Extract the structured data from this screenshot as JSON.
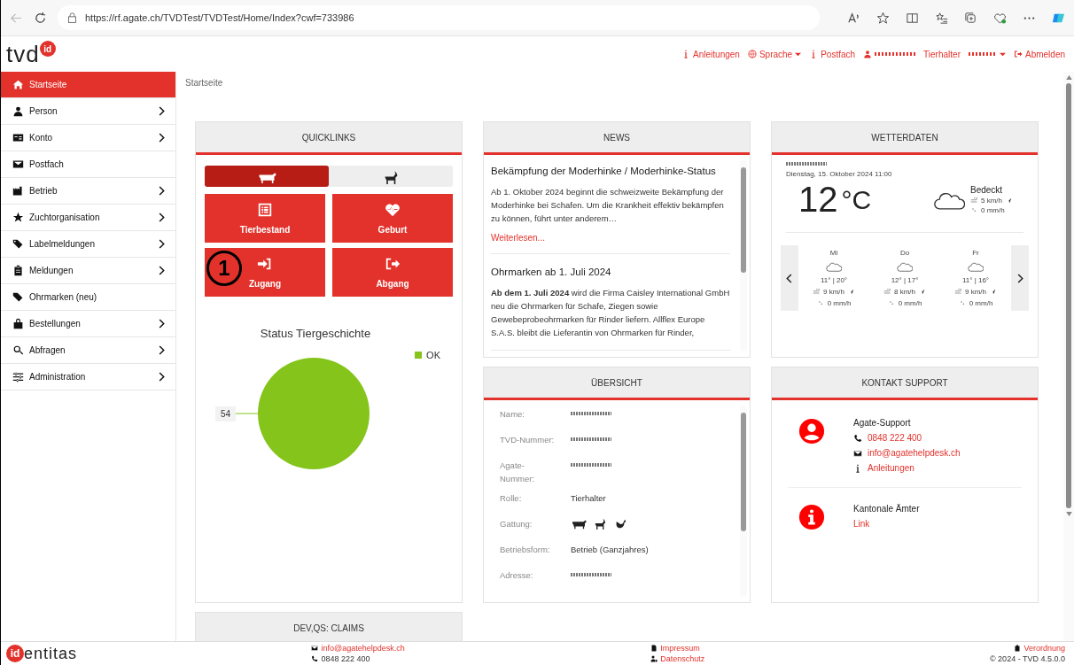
{
  "browser": {
    "url": "https://rf.agate.ch/TVDTest/TVDTest/Home/Index?cwf=733986"
  },
  "header": {
    "logo_text": "tvd",
    "logo_badge": "id",
    "nav": [
      {
        "kind": "link",
        "label": "Anleitungen"
      },
      {
        "kind": "dropdown",
        "label": "Sprache"
      },
      {
        "kind": "link",
        "label": "Postfach"
      },
      {
        "kind": "user"
      },
      {
        "kind": "role",
        "label": "Tierhalter"
      },
      {
        "kind": "logout",
        "label": "Abmelden"
      }
    ]
  },
  "sidebar": {
    "items": [
      {
        "label": "Startseite",
        "selected": true,
        "expandable": false
      },
      {
        "label": "Person",
        "selected": false,
        "expandable": true
      },
      {
        "label": "Konto",
        "selected": false,
        "expandable": true
      },
      {
        "label": "Postfach",
        "selected": false,
        "expandable": false
      },
      {
        "label": "Betrieb",
        "selected": false,
        "expandable": true
      },
      {
        "label": "Zuchtorganisation",
        "selected": false,
        "expandable": true
      },
      {
        "label": "Labelmeldungen",
        "selected": false,
        "expandable": true
      },
      {
        "label": "Meldungen",
        "selected": false,
        "expandable": true
      },
      {
        "label": "Ohrmarken (neu)",
        "selected": false,
        "expandable": false
      },
      {
        "label": "Bestellungen",
        "selected": false,
        "expandable": true
      },
      {
        "label": "Abfragen",
        "selected": false,
        "expandable": true
      },
      {
        "label": "Administration",
        "selected": false,
        "expandable": true
      }
    ]
  },
  "breadcrumb": "Startseite",
  "quicklinks": {
    "title": "QUICKLINKS",
    "species_tabs": [
      {
        "selected": true
      },
      {
        "selected": false
      }
    ],
    "tiles": [
      {
        "label": "Tierbestand"
      },
      {
        "label": "Geburt"
      },
      {
        "label": "Zugang"
      },
      {
        "label": "Abgang"
      }
    ],
    "annotation_marker": "1",
    "chart_data": {
      "type": "pie",
      "title": "Status Tiergeschichte",
      "series": [
        {
          "name": "OK",
          "color": "#84c41b",
          "values": [
            54
          ]
        }
      ],
      "data_labels": true
    }
  },
  "news": {
    "title": "NEWS",
    "items": [
      {
        "title": "Bekämpfung der Moderhinke / Moderhinke-Status",
        "body": "Ab 1. Oktober 2024 beginnt die schweizweite Bekämpfung der Moderhinke bei Schafen. Um die Krankheit effektiv bekämpfen zu können, führt unter anderem…",
        "link": "Weiterlesen..."
      },
      {
        "title": "Ohrmarken ab 1. Juli 2024",
        "body": "**Ab dem 1. Juli 2024** wird die Firma Caisley International GmbH neu die Ohrmarken für Schafe, Ziegen sowie Gewebeprobeohrmarken für Rinder liefern. Allflex Europe S.A.S. bleibt die Lieferantin von Ohrmarken für Rinder,"
      }
    ]
  },
  "weather": {
    "title": "WETTERDATEN",
    "datetime": "Dienstag, 15. Oktober 2024 11:00",
    "temperature": "12",
    "unit": "°C",
    "condition": "Bedeckt",
    "wind": "5 km/h",
    "rain": "0 mm/h",
    "forecast": [
      {
        "day": "Mi",
        "temps": "11° | 20°",
        "wind": "9 km/h",
        "rain": "0 mm/h"
      },
      {
        "day": "Do",
        "temps": "12° | 17°",
        "wind": "8 km/h",
        "rain": "0 mm/h"
      },
      {
        "day": "Fr",
        "temps": "11° | 16°",
        "wind": "9 km/h",
        "rain": "0 mm/h"
      }
    ]
  },
  "overview": {
    "title": "ÜBERSICHT",
    "rows": [
      {
        "label": "Name:",
        "kind": "redacted"
      },
      {
        "label": "TVD-Nummer:",
        "kind": "redacted"
      },
      {
        "label": "Agate-Nummer:",
        "kind": "redacted"
      },
      {
        "label": "Rolle:",
        "kind": "text",
        "value": "Tierhalter"
      },
      {
        "label": "Gattung:",
        "kind": "species"
      },
      {
        "label": "Betriebsform:",
        "kind": "text",
        "value": "Betrieb (Ganzjahres)"
      },
      {
        "label": "Adresse:",
        "kind": "redacted"
      }
    ]
  },
  "support": {
    "title": "KONTAKT SUPPORT",
    "sections": [
      {
        "kind": "person",
        "name": "Agate-Support",
        "links": [
          {
            "kind": "phone",
            "text": "0848 222 400"
          },
          {
            "kind": "mail",
            "text": "info@agatehelpdesk.ch"
          },
          {
            "kind": "info",
            "text": "Anleitungen"
          }
        ]
      },
      {
        "kind": "info",
        "name": "Kantonale Ämter",
        "links": [
          {
            "kind": "plain",
            "text": "Link"
          }
        ]
      }
    ]
  },
  "claims": {
    "title": "DEV,QS: CLAIMS"
  },
  "footer": {
    "logo_badge": "id",
    "logo_text": "entitas",
    "email": "info@agatehelpdesk.ch",
    "phone": "0848 222 400",
    "impressum": "Impressum",
    "privacy": "Datenschutz",
    "ordinance": "Verordnung",
    "version": "© 2024 - TVD 4.5.0.0"
  }
}
